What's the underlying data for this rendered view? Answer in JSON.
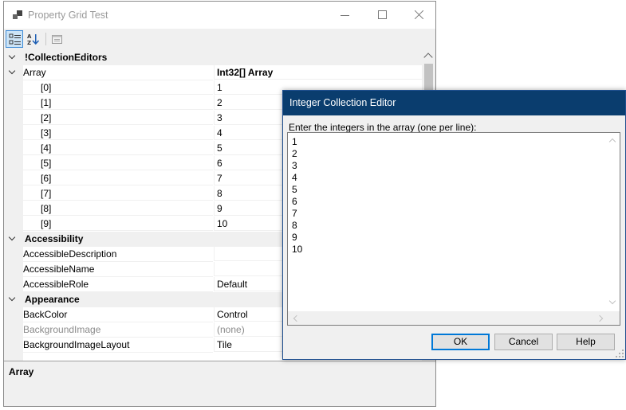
{
  "window": {
    "title": "Property Grid Test",
    "toolbar": {
      "categorized_icon": "categorized-view-icon",
      "alphabetical_icon": "alphabetical-sort-icon",
      "property_pages_icon": "property-pages-icon"
    }
  },
  "grid": {
    "categories": [
      {
        "name": "!CollectionEditors",
        "rows": [
          {
            "name": "Array",
            "value": "Int32[] Array",
            "value_bold": true,
            "children": [
              {
                "name": "[0]",
                "value": "1"
              },
              {
                "name": "[1]",
                "value": "2"
              },
              {
                "name": "[2]",
                "value": "3"
              },
              {
                "name": "[3]",
                "value": "4"
              },
              {
                "name": "[4]",
                "value": "5"
              },
              {
                "name": "[5]",
                "value": "6"
              },
              {
                "name": "[6]",
                "value": "7"
              },
              {
                "name": "[7]",
                "value": "8"
              },
              {
                "name": "[8]",
                "value": "9"
              },
              {
                "name": "[9]",
                "value": "10"
              }
            ]
          }
        ]
      },
      {
        "name": "Accessibility",
        "rows": [
          {
            "name": "AccessibleDescription",
            "value": ""
          },
          {
            "name": "AccessibleName",
            "value": ""
          },
          {
            "name": "AccessibleRole",
            "value": "Default"
          }
        ]
      },
      {
        "name": "Appearance",
        "rows": [
          {
            "name": "BackColor",
            "value": "Control"
          },
          {
            "name": "BackgroundImage",
            "value": "(none)",
            "grayed": true
          },
          {
            "name": "BackgroundImageLayout",
            "value": "Tile"
          }
        ]
      }
    ],
    "description_title": "Array"
  },
  "dialog": {
    "title": "Integer Collection Editor",
    "prompt": "Enter the integers in the array (one per line):",
    "lines": [
      "1",
      "2",
      "3",
      "4",
      "5",
      "6",
      "7",
      "8",
      "9",
      "10"
    ],
    "ok_label": "OK",
    "cancel_label": "Cancel",
    "help_label": "Help"
  },
  "colors": {
    "dialog_title_bg": "#0a3d6e",
    "default_button_border": "#0078d7",
    "toolbar_active_bg": "#cce4f7"
  }
}
